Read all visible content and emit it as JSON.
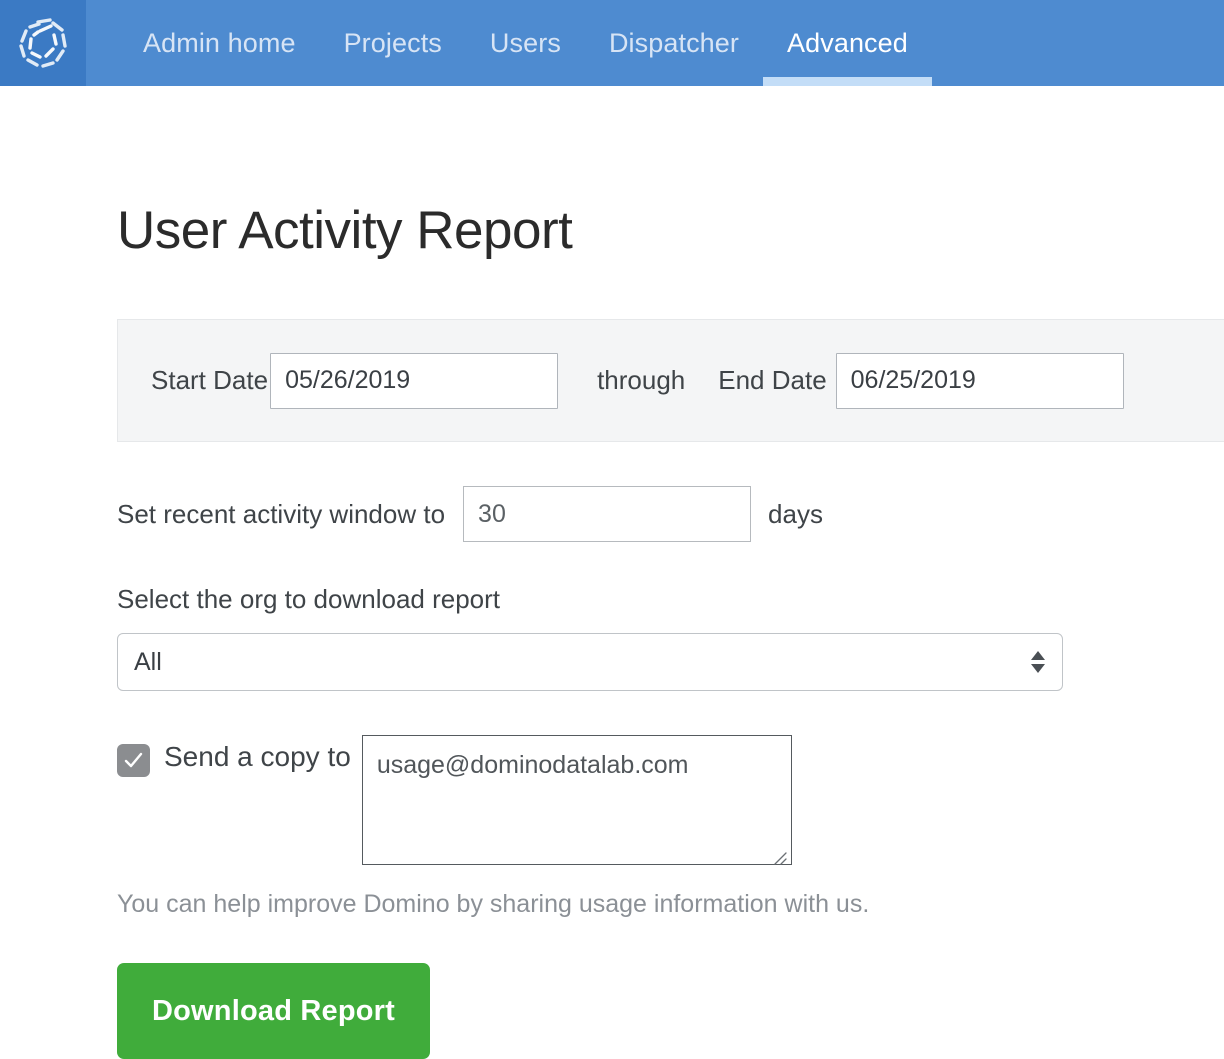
{
  "colors": {
    "nav_background": "#4e8bd0",
    "nav_logo_block": "#3b7ac4",
    "nav_active_underline": "#c3ddf7",
    "panel_background": "#f4f5f6",
    "primary_button": "#40ac3b",
    "checkbox_fill": "#8b8d90"
  },
  "navbar": {
    "logo_icon": "domino-swirl-logo-icon",
    "items": [
      {
        "label": "Admin home",
        "active": false
      },
      {
        "label": "Projects",
        "active": false
      },
      {
        "label": "Users",
        "active": false
      },
      {
        "label": "Dispatcher",
        "active": false
      },
      {
        "label": "Advanced",
        "active": true
      }
    ]
  },
  "page": {
    "title": "User Activity Report"
  },
  "date_panel": {
    "start_label": "Start Date",
    "start_value": "05/26/2019",
    "start_placeholder": "mm/dd/yyyy",
    "through_label": "through",
    "end_label": "End Date",
    "end_value": "06/25/2019",
    "end_placeholder": "mm/dd/yyyy"
  },
  "activity_window": {
    "label": "Set recent activity window to",
    "value": "30",
    "placeholder": "30",
    "unit_label": "days"
  },
  "org_select": {
    "label": "Select the org to download report",
    "selected": "All",
    "options": [
      "All"
    ],
    "arrow_icon": "select-updown-arrows-icon"
  },
  "send_copy": {
    "checked": true,
    "checkbox_icon": "checkmark-icon",
    "label": "Send a copy to",
    "email_value": "usage@dominodatalab.com",
    "email_placeholder": "usage@dominodatalab.com",
    "resize_icon": "resize-grip-icon"
  },
  "help_text": "You can help improve Domino by sharing usage information with us.",
  "download_button": {
    "label": "Download Report"
  }
}
